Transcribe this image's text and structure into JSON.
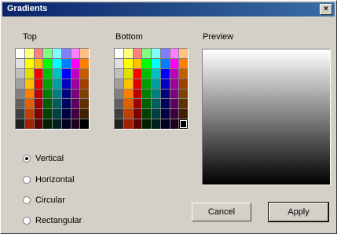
{
  "window": {
    "title": "Gradients",
    "close_glyph": "×"
  },
  "labels": {
    "top": "Top",
    "bottom": "Bottom",
    "preview": "Preview"
  },
  "palette": [
    [
      "#ffffff",
      "#ffff80",
      "#ff8080",
      "#80ff80",
      "#80ffff",
      "#8080ff",
      "#ff80ff",
      "#ffc080"
    ],
    [
      "#e0e0e0",
      "#ffff00",
      "#ffc000",
      "#00ff00",
      "#00ffff",
      "#0080ff",
      "#ff00ff",
      "#ff8000"
    ],
    [
      "#c0c0c0",
      "#e0e000",
      "#ff0000",
      "#00c000",
      "#00c0c0",
      "#0000ff",
      "#c000c0",
      "#c06000"
    ],
    [
      "#a0a0a0",
      "#ffc000",
      "#e00000",
      "#00a000",
      "#00a0a0",
      "#0000c0",
      "#a000a0",
      "#a04000"
    ],
    [
      "#808080",
      "#ff8000",
      "#c00000",
      "#008000",
      "#008080",
      "#000080",
      "#800080",
      "#804000"
    ],
    [
      "#606060",
      "#e06000",
      "#a00000",
      "#006000",
      "#006060",
      "#000060",
      "#600060",
      "#603000"
    ],
    [
      "#404040",
      "#c04000",
      "#800000",
      "#004000",
      "#004040",
      "#000040",
      "#400040",
      "#402000"
    ],
    [
      "#202020",
      "#a02000",
      "#600000",
      "#002000",
      "#002020",
      "#000020",
      "#200020",
      "#000000"
    ]
  ],
  "top_selected": "0,0",
  "bottom_selected": "7,7",
  "orientation": {
    "options": [
      "Vertical",
      "Horizontal",
      "Circular",
      "Rectangular"
    ],
    "selected": "Vertical"
  },
  "buttons": {
    "cancel": "Cancel",
    "apply": "Apply"
  }
}
